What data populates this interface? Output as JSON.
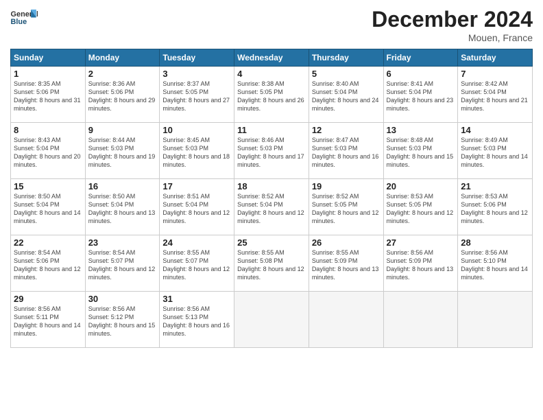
{
  "header": {
    "logo_general": "General",
    "logo_blue": "Blue",
    "month_title": "December 2024",
    "location": "Mouen, France"
  },
  "days_of_week": [
    "Sunday",
    "Monday",
    "Tuesday",
    "Wednesday",
    "Thursday",
    "Friday",
    "Saturday"
  ],
  "weeks": [
    [
      {
        "day": 1,
        "info": "Sunrise: 8:35 AM\nSunset: 5:06 PM\nDaylight: 8 hours\nand 31 minutes."
      },
      {
        "day": 2,
        "info": "Sunrise: 8:36 AM\nSunset: 5:06 PM\nDaylight: 8 hours\nand 29 minutes."
      },
      {
        "day": 3,
        "info": "Sunrise: 8:37 AM\nSunset: 5:05 PM\nDaylight: 8 hours\nand 27 minutes."
      },
      {
        "day": 4,
        "info": "Sunrise: 8:38 AM\nSunset: 5:05 PM\nDaylight: 8 hours\nand 26 minutes."
      },
      {
        "day": 5,
        "info": "Sunrise: 8:40 AM\nSunset: 5:04 PM\nDaylight: 8 hours\nand 24 minutes."
      },
      {
        "day": 6,
        "info": "Sunrise: 8:41 AM\nSunset: 5:04 PM\nDaylight: 8 hours\nand 23 minutes."
      },
      {
        "day": 7,
        "info": "Sunrise: 8:42 AM\nSunset: 5:04 PM\nDaylight: 8 hours\nand 21 minutes."
      }
    ],
    [
      {
        "day": 8,
        "info": "Sunrise: 8:43 AM\nSunset: 5:04 PM\nDaylight: 8 hours\nand 20 minutes."
      },
      {
        "day": 9,
        "info": "Sunrise: 8:44 AM\nSunset: 5:03 PM\nDaylight: 8 hours\nand 19 minutes."
      },
      {
        "day": 10,
        "info": "Sunrise: 8:45 AM\nSunset: 5:03 PM\nDaylight: 8 hours\nand 18 minutes."
      },
      {
        "day": 11,
        "info": "Sunrise: 8:46 AM\nSunset: 5:03 PM\nDaylight: 8 hours\nand 17 minutes."
      },
      {
        "day": 12,
        "info": "Sunrise: 8:47 AM\nSunset: 5:03 PM\nDaylight: 8 hours\nand 16 minutes."
      },
      {
        "day": 13,
        "info": "Sunrise: 8:48 AM\nSunset: 5:03 PM\nDaylight: 8 hours\nand 15 minutes."
      },
      {
        "day": 14,
        "info": "Sunrise: 8:49 AM\nSunset: 5:03 PM\nDaylight: 8 hours\nand 14 minutes."
      }
    ],
    [
      {
        "day": 15,
        "info": "Sunrise: 8:50 AM\nSunset: 5:04 PM\nDaylight: 8 hours\nand 14 minutes."
      },
      {
        "day": 16,
        "info": "Sunrise: 8:50 AM\nSunset: 5:04 PM\nDaylight: 8 hours\nand 13 minutes."
      },
      {
        "day": 17,
        "info": "Sunrise: 8:51 AM\nSunset: 5:04 PM\nDaylight: 8 hours\nand 12 minutes."
      },
      {
        "day": 18,
        "info": "Sunrise: 8:52 AM\nSunset: 5:04 PM\nDaylight: 8 hours\nand 12 minutes."
      },
      {
        "day": 19,
        "info": "Sunrise: 8:52 AM\nSunset: 5:05 PM\nDaylight: 8 hours\nand 12 minutes."
      },
      {
        "day": 20,
        "info": "Sunrise: 8:53 AM\nSunset: 5:05 PM\nDaylight: 8 hours\nand 12 minutes."
      },
      {
        "day": 21,
        "info": "Sunrise: 8:53 AM\nSunset: 5:06 PM\nDaylight: 8 hours\nand 12 minutes."
      }
    ],
    [
      {
        "day": 22,
        "info": "Sunrise: 8:54 AM\nSunset: 5:06 PM\nDaylight: 8 hours\nand 12 minutes."
      },
      {
        "day": 23,
        "info": "Sunrise: 8:54 AM\nSunset: 5:07 PM\nDaylight: 8 hours\nand 12 minutes."
      },
      {
        "day": 24,
        "info": "Sunrise: 8:55 AM\nSunset: 5:07 PM\nDaylight: 8 hours\nand 12 minutes."
      },
      {
        "day": 25,
        "info": "Sunrise: 8:55 AM\nSunset: 5:08 PM\nDaylight: 8 hours\nand 12 minutes."
      },
      {
        "day": 26,
        "info": "Sunrise: 8:55 AM\nSunset: 5:09 PM\nDaylight: 8 hours\nand 13 minutes."
      },
      {
        "day": 27,
        "info": "Sunrise: 8:56 AM\nSunset: 5:09 PM\nDaylight: 8 hours\nand 13 minutes."
      },
      {
        "day": 28,
        "info": "Sunrise: 8:56 AM\nSunset: 5:10 PM\nDaylight: 8 hours\nand 14 minutes."
      }
    ],
    [
      {
        "day": 29,
        "info": "Sunrise: 8:56 AM\nSunset: 5:11 PM\nDaylight: 8 hours\nand 14 minutes."
      },
      {
        "day": 30,
        "info": "Sunrise: 8:56 AM\nSunset: 5:12 PM\nDaylight: 8 hours\nand 15 minutes."
      },
      {
        "day": 31,
        "info": "Sunrise: 8:56 AM\nSunset: 5:13 PM\nDaylight: 8 hours\nand 16 minutes."
      },
      null,
      null,
      null,
      null
    ]
  ]
}
